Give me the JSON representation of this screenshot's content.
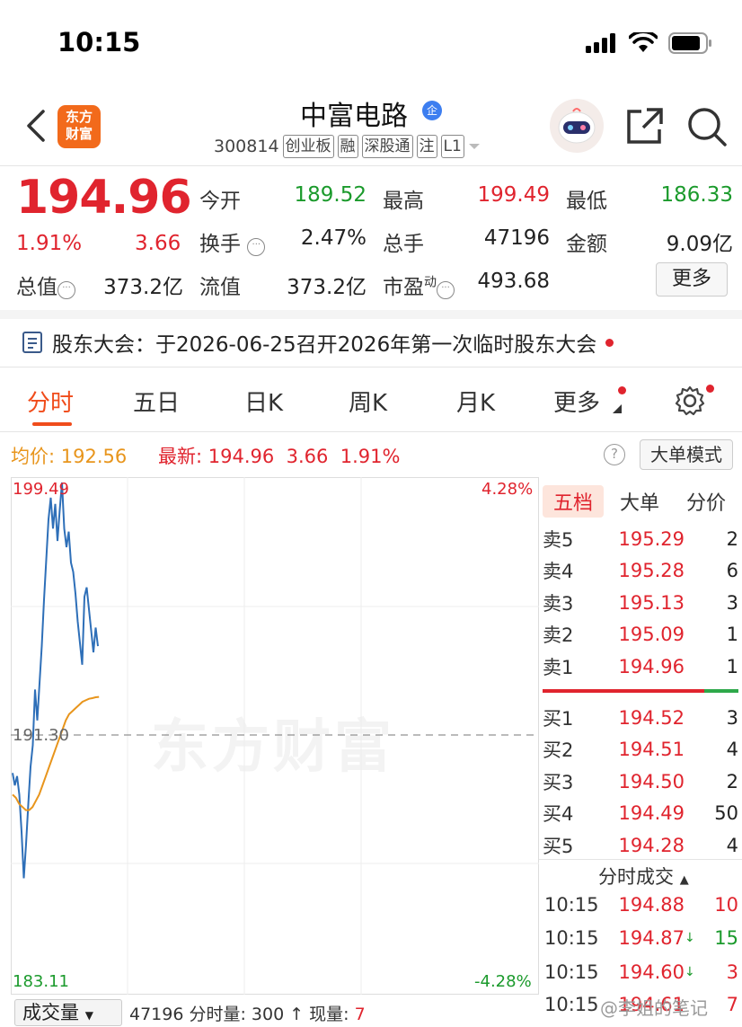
{
  "status_bar": {
    "time": "10:15"
  },
  "header": {
    "logo_text": "东方财富",
    "stock_name": "中富电路",
    "ent_badge": "企",
    "code": "300814",
    "tags": [
      "创业板",
      "融",
      "深股通",
      "注",
      "L1"
    ]
  },
  "quote": {
    "price": "194.96",
    "change_pct": "1.91%",
    "change_amt": "3.66",
    "open_label": "今开",
    "open": "189.52",
    "high_label": "最高",
    "high": "199.49",
    "low_label": "最低",
    "low": "186.33",
    "turnover_label": "换手",
    "turnover": "2.47%",
    "volume_label": "总手",
    "volume": "47196",
    "amount_label": "金额",
    "amount": "9.09亿",
    "mktcap_label": "总值",
    "mktcap": "373.2亿",
    "float_label": "流值",
    "float_cap": "373.2亿",
    "pe_label": "市盈",
    "pe_sup": "动",
    "pe": "493.68",
    "more_label": "更多"
  },
  "notice": {
    "text": "股东大会：于2026-06-25召开2026年第一次临时股东大会"
  },
  "tabs": [
    "分时",
    "五日",
    "日K",
    "周K",
    "月K",
    "更多"
  ],
  "avg_row": {
    "avg_label": "均价:",
    "avg": "192.56",
    "latest_label": "最新:",
    "latest": "194.96",
    "chg": "3.66",
    "pct": "1.91%",
    "help": "?",
    "big_order_btn": "大单模式"
  },
  "chart_labels": {
    "y_top": "199.49",
    "y_mid": "191.30",
    "y_bottom": "183.11",
    "pct_top": "4.28%",
    "pct_bottom": "-4.28%",
    "watermark": "东方财富"
  },
  "chart_data": {
    "type": "line",
    "ylim": [
      183.11,
      199.49
    ],
    "prev_close": 191.3,
    "series": [
      {
        "values": [
          190.1,
          189.7,
          190.0,
          189.4,
          188.2,
          186.7,
          187.8,
          189.1,
          190.3,
          191.0,
          192.8,
          191.8,
          193.0,
          194.2,
          195.7,
          197.0,
          198.3,
          199.0,
          198.0,
          198.8,
          197.6,
          198.6,
          199.49,
          198.0,
          197.4,
          197.9,
          196.9,
          196.6,
          195.9,
          195.0,
          194.3,
          193.6,
          195.8,
          196.1,
          195.4,
          194.7,
          194.0,
          194.8,
          194.2
        ]
      },
      {
        "values": [
          189.4,
          189.3,
          189.1,
          189.0,
          188.9,
          188.9,
          189.0,
          189.2,
          189.4,
          189.7,
          190.0,
          190.3,
          190.6,
          190.9,
          191.2,
          191.5,
          191.8,
          192.0,
          192.1,
          192.2,
          192.3,
          192.4,
          192.45,
          192.5,
          192.52,
          192.55,
          192.56
        ]
      }
    ]
  },
  "order_book": {
    "tabs": [
      "五档",
      "大单",
      "分价"
    ],
    "asks": [
      {
        "label": "卖5",
        "price": "195.29",
        "vol": "2"
      },
      {
        "label": "卖4",
        "price": "195.28",
        "vol": "6"
      },
      {
        "label": "卖3",
        "price": "195.13",
        "vol": "3"
      },
      {
        "label": "卖2",
        "price": "195.09",
        "vol": "1"
      },
      {
        "label": "卖1",
        "price": "194.96",
        "vol": "1"
      }
    ],
    "bids": [
      {
        "label": "买1",
        "price": "194.52",
        "vol": "3"
      },
      {
        "label": "买2",
        "price": "194.51",
        "vol": "4"
      },
      {
        "label": "买3",
        "price": "194.50",
        "vol": "2"
      },
      {
        "label": "买4",
        "price": "194.49",
        "vol": "50"
      },
      {
        "label": "买5",
        "price": "194.28",
        "vol": "4"
      }
    ],
    "ticks_title": "分时成交",
    "ticks": [
      {
        "time": "10:15",
        "price": "194.88",
        "arrow": "",
        "vol": "10"
      },
      {
        "time": "10:15",
        "price": "194.87",
        "arrow": "↓",
        "vol": "15"
      },
      {
        "time": "10:15",
        "price": "194.60",
        "arrow": "↓",
        "vol": "3"
      },
      {
        "time": "10:15",
        "price": "194.61",
        "arrow": "",
        "vol": "7"
      }
    ]
  },
  "bottom": {
    "vol_btn": "成交量",
    "stats": "47196 分时量: 300 ↑ 现量: ",
    "now_vol": "7",
    "corner_watermark": "@李姐的笔记"
  },
  "colors": {
    "up": "#e0242e",
    "down": "#1b9a2c",
    "accent": "#f04c1b",
    "price_line": "#2e6fb8",
    "avg_line": "#e8951c"
  }
}
